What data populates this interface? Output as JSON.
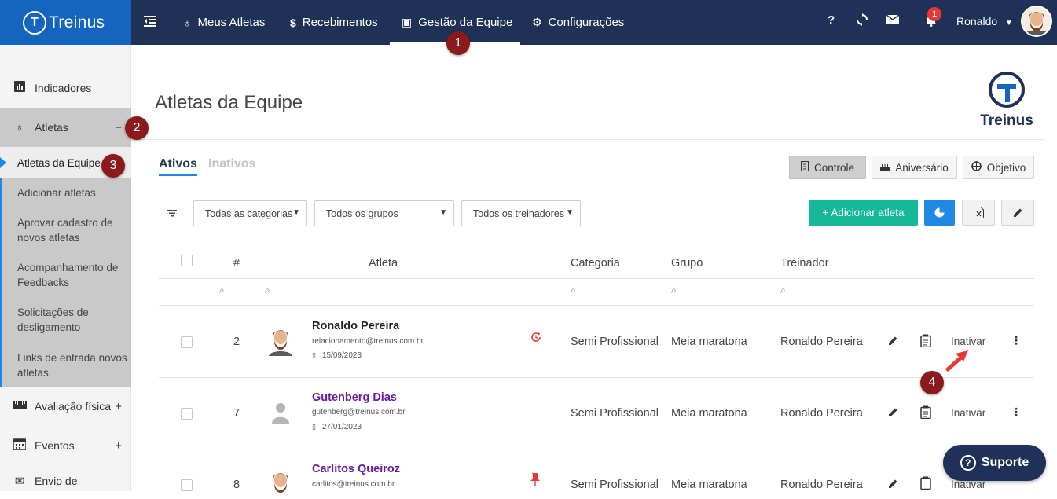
{
  "brand": {
    "name": "Treinus"
  },
  "nav": {
    "items": [
      {
        "label": "Meus Atletas",
        "icon": "medal-icon"
      },
      {
        "label": "Recebimentos",
        "icon": "dollar-icon"
      },
      {
        "label": "Gestão da Equipe",
        "icon": "id-card-icon"
      },
      {
        "label": "Configurações",
        "icon": "gears-icon"
      }
    ],
    "active": "Gestão da Equipe",
    "help": "?",
    "notifications_count": "1",
    "user_name": "Ronaldo"
  },
  "callouts": [
    "1",
    "2",
    "3",
    "4"
  ],
  "sidebar": {
    "items": [
      {
        "label": "Indicadores",
        "marker": ""
      },
      {
        "label": "Atletas",
        "marker": "−"
      },
      {
        "label": "Avaliação física",
        "marker": "+"
      },
      {
        "label": "Eventos",
        "marker": "+"
      },
      {
        "label": "Envio de",
        "marker": ""
      }
    ],
    "sub_items": [
      "Atletas da Equipe",
      "Adicionar atletas",
      "Aprovar cadastro de novos atletas",
      "Acompanhamento de Feedbacks",
      "Solicitações de desligamento",
      "Links de entrada novos atletas"
    ]
  },
  "page": {
    "title": "Atletas da Equipe",
    "logo_text": "Treinus"
  },
  "tabs": {
    "active": "Ativos",
    "inactive": "Inativos"
  },
  "views": {
    "controle": "Controle",
    "aniversario": "Aniversário",
    "objetivo": "Objetivo"
  },
  "filters": {
    "categorias": "Todas as categorias",
    "grupos": "Todos os grupos",
    "treinadores": "Todos os treinadores"
  },
  "actions": {
    "add_athlete": "+ Adicionar atleta"
  },
  "table": {
    "columns": {
      "num": "#",
      "atleta": "Atleta",
      "categoria": "Categoria",
      "grupo": "Grupo",
      "treinador": "Treinador"
    },
    "rows": [
      {
        "num": "2",
        "name": "Ronaldo Pereira",
        "email": "relacionamento@treinus.com.br",
        "date": "15/09/2023",
        "categoria": "Semi Profissional",
        "grupo": "Meia maratona",
        "treinador": "Ronaldo Pereira",
        "action": "Inativar",
        "name_color": "#222222",
        "status_icon": "recurring-icon"
      },
      {
        "num": "7",
        "name": "Gutenberg Dias",
        "email": "gutenberg@treinus.com.br",
        "date": "27/01/2023",
        "categoria": "Semi Profissional",
        "grupo": "Meia maratona",
        "treinador": "Ronaldo Pereira",
        "action": "Inativar",
        "name_color": "#6a1b9a",
        "status_icon": ""
      },
      {
        "num": "8",
        "name": "Carlitos Queiroz",
        "email": "carlitos@treinus.com.br",
        "date": "",
        "categoria": "Semi Profissional",
        "grupo": "Meia maratona",
        "treinador": "Ronaldo Pereira",
        "action": "Inativar",
        "name_color": "#6a1b9a",
        "status_icon": "pin-icon"
      }
    ]
  },
  "support": {
    "label": "Suporte"
  },
  "colors": {
    "topbar": "#1f3156",
    "brand": "#1565c0",
    "accent": "#1e88e5",
    "add_button": "#17b89a",
    "callout": "#8b1a1a"
  }
}
